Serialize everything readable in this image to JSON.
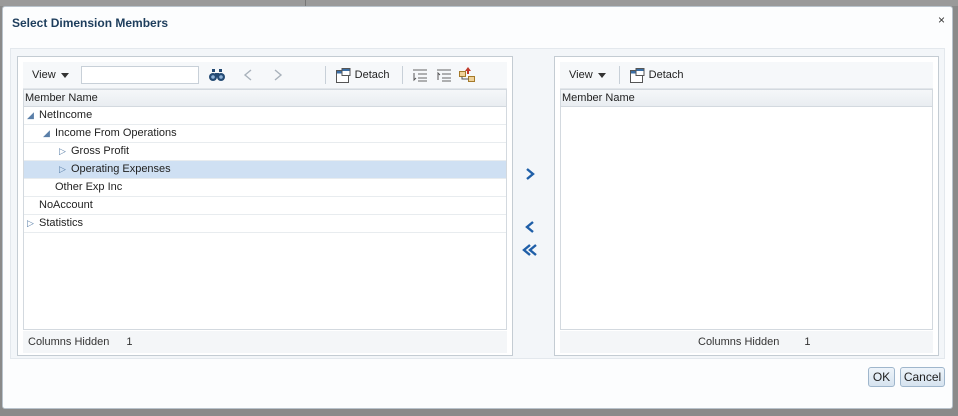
{
  "dialog": {
    "title": "Select Dimension Members",
    "close_label": "×",
    "ok_label": "OK",
    "cancel_label": "Cancel"
  },
  "left_panel": {
    "toolbar": {
      "view_label": "View",
      "search_value": "",
      "detach_label": "Detach"
    },
    "column_header": "Member Name",
    "rows": [
      {
        "label": "NetIncome",
        "expand": "expanded",
        "level": 0,
        "selected": false
      },
      {
        "label": "Income From Operations",
        "expand": "expanded",
        "level": 1,
        "selected": false
      },
      {
        "label": "Gross Profit",
        "expand": "collapsed",
        "level": 2,
        "selected": false
      },
      {
        "label": "Operating Expenses",
        "expand": "collapsed",
        "level": 2,
        "selected": true
      },
      {
        "label": "Other Exp Inc",
        "expand": "none",
        "level": 1,
        "selected": false
      },
      {
        "label": "NoAccount",
        "expand": "none",
        "level": 0,
        "selected": false
      },
      {
        "label": "Statistics",
        "expand": "collapsed",
        "level": 0,
        "selected": false
      }
    ],
    "status": {
      "columns_hidden_label": "Columns Hidden",
      "columns_hidden_value": "1"
    }
  },
  "right_panel": {
    "toolbar": {
      "view_label": "View",
      "detach_label": "Detach"
    },
    "column_header": "Member Name",
    "status": {
      "columns_hidden_label": "Columns Hidden",
      "columns_hidden_value": "1"
    }
  },
  "icons": {
    "find": "binoculars-icon",
    "previous": "chevron-left-icon",
    "next": "chevron-right-icon",
    "detach": "detach-icon",
    "expand": "expand-all-icon",
    "collapse": "collapse-all-icon",
    "member_properties": "member-properties-icon",
    "move": "move-right-icon",
    "remove": "move-left-icon",
    "remove_all": "remove-all-icon"
  },
  "colors": {
    "accent": "#1f5fa8",
    "selection": "#cfe0f3",
    "title": "#1d3d5c"
  }
}
